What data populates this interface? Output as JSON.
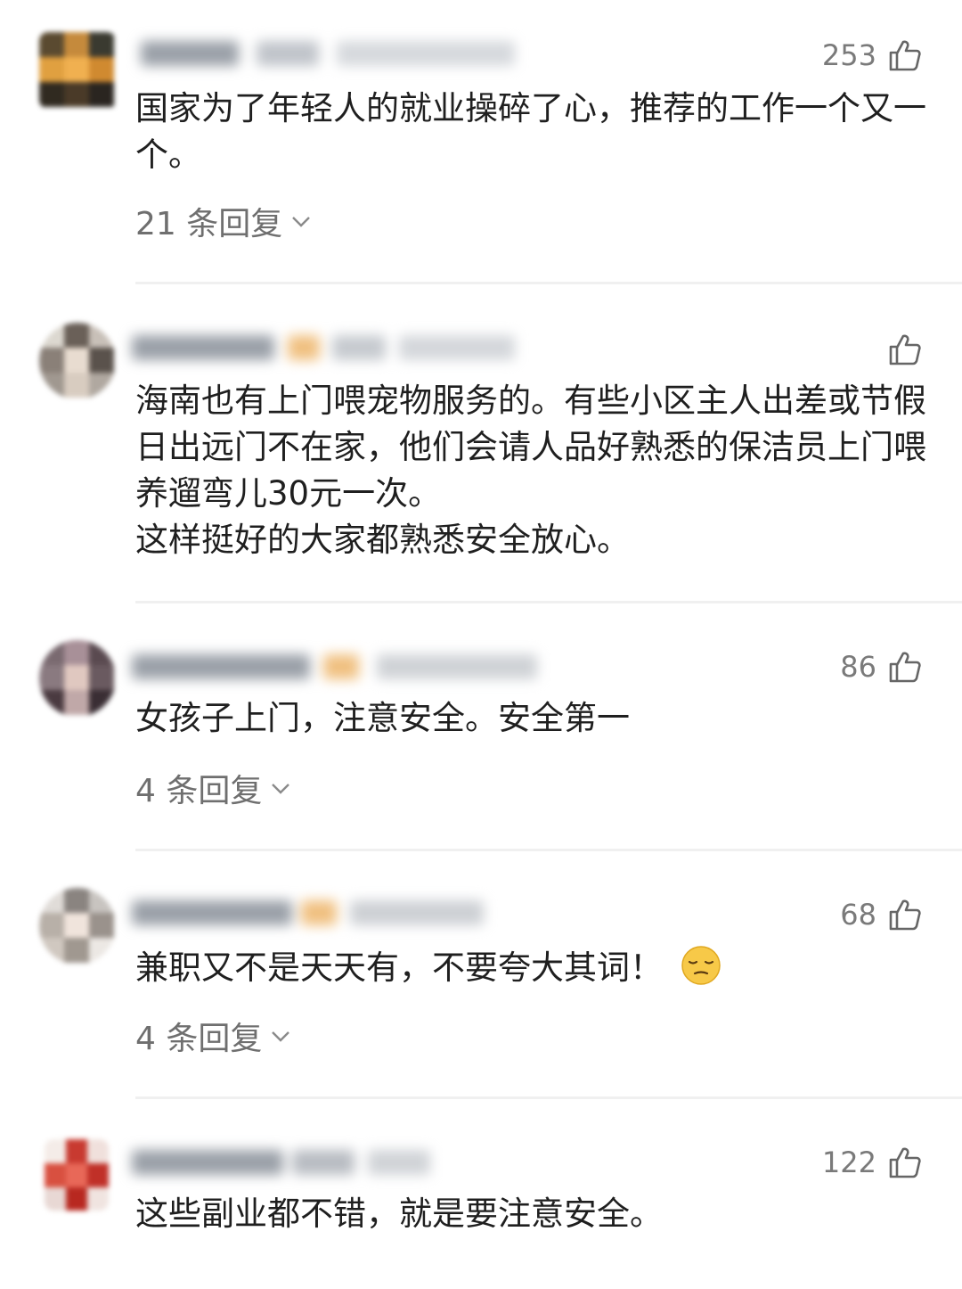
{
  "comments": [
    {
      "likes": "253",
      "text": "国家为了年轻人的就业操碎了心，推荐的工作一个又一个。",
      "replies": "21 条回复"
    },
    {
      "likes": "",
      "text": "海南也有上门喂宠物服务的。有些小区主人出差或节假日出远门不在家，他们会请人品好熟悉的保洁员上门喂养遛弯儿30元一次。\n这样挺好的大家都熟悉安全放心。",
      "replies": ""
    },
    {
      "likes": "86",
      "text": "女孩子上门，注意安全。安全第一",
      "replies": "4 条回复"
    },
    {
      "likes": "68",
      "text": "兼职又不是天天有，不要夸大其词！",
      "emoji": "pensive-face-emoji",
      "replies": "4 条回复"
    },
    {
      "likes": "122",
      "text": "这些副业都不错，就是要注意安全。",
      "replies": ""
    }
  ],
  "icons": {
    "like": "thumbs-up-icon",
    "expand": "chevron-down-icon"
  },
  "colors": {
    "text": "#1f1f1f",
    "meta": "#7a7a7a",
    "divider": "#f0f0f0"
  }
}
